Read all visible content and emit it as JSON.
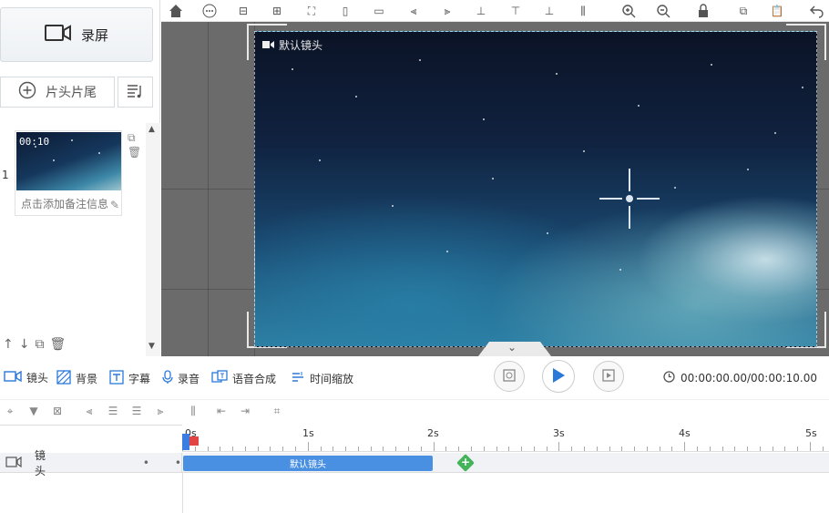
{
  "left_panel": {
    "record_label": "录屏",
    "intro_outro_label": "片头片尾",
    "scene": {
      "index": "1",
      "duration": "00:10",
      "note_placeholder": "点击添加备注信息"
    }
  },
  "stage": {
    "camera_label": "默认镜头"
  },
  "tracks_toolbar": {
    "camera": "镜头",
    "background": "背景",
    "subtitle": "字幕",
    "record_audio": "录音",
    "tts": "语音合成",
    "time_scale": "时间缩放"
  },
  "playback": {
    "time": "00:00:00.00/00:00:10.00"
  },
  "timeline": {
    "ruler_labels": [
      "0s",
      "1s",
      "2s",
      "3s",
      "4s",
      "5s"
    ],
    "track_name": "镜头",
    "clip_label": "默认镜头"
  },
  "icons": {
    "record": "camera-outline-icon",
    "add": "plus-circle-icon",
    "list": "list-music-icon",
    "play": "play-icon"
  },
  "colors": {
    "accent": "#4a90e2",
    "play": "#2a78d8",
    "node": "#44b35a",
    "marker_red": "#e24444"
  }
}
